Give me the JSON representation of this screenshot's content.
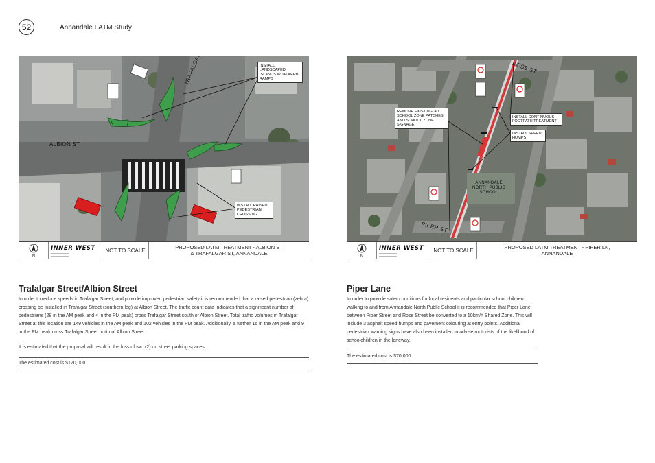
{
  "header": {
    "page_number": "52",
    "document_title": "Annandale LATM Study"
  },
  "left_panel": {
    "map": {
      "street_labels": [
        "TRAFALGAR ST",
        "ALBION ST"
      ],
      "callouts": [
        "INSTALL\nLANDSCAPED\nISLANDS WITH KERB\nRAMPS",
        "INSTALL RAISED\nPEDESTRIAN\nCROSSING"
      ]
    },
    "title_block": {
      "north_label": "N",
      "brand": "INNER WEST",
      "scale": "NOT TO SCALE",
      "title": "PROPOSED LATM TREATMENT - ALBION ST\n& TRAFALGAR ST,  ANNANDALE"
    },
    "heading": "Trafalgar Street/Albion Street",
    "paragraph_1": "In order to reduce speeds in Trafalgar Street, and provide improved pedestrian safety it is recommended that a raised pedestrian (zebra) crossing be installed in Trafalgar Street (southern leg) at Albion Street.  The traffic count data indicates that a significant number of pedestrians (28 in the AM peak and 4 in the PM peak) cross Trafalgar Street south of Albion Street. Total traffic volumes in Trafalgar Street at this location are 149 vehicles in the AM peak and 102 vehicles in the PM peak. Additionally, a further 16 in the AM peak and 9 in the PM peak cross Trafalgar Street north of Albion Street.",
    "paragraph_2": "It is estimated that the proposal will result in the loss of two (2) on street parking spaces.",
    "cost": "The estimated cost is $120,000."
  },
  "right_panel": {
    "map": {
      "street_labels": [
        "ROSE ST",
        "PIPER ST"
      ],
      "callouts": [
        "REMOVE EXISTING '40'\nSCHOOL ZONE PATCHES\nAND SCHOOL ZONE\nSIGNAGE",
        "INSTALL CONTINUOUS\nFOOTPATH TREATMENT",
        "INSTALL SPEED\nHUMPS"
      ],
      "school_label": "ANNANDALE\nNORTH PUBLIC\nSCHOOL"
    },
    "title_block": {
      "north_label": "N",
      "brand": "INNER WEST",
      "scale": "NOT TO SCALE",
      "title": "PROPOSED LATM TREATMENT - PIPER LN,\nANNANDALE"
    },
    "heading": "Piper Lane",
    "paragraph_1": "In order to provide safer conditions for local residents and particular school children walking to and from Annandale North Public School it is recommended that Piper Lane between Piper Street and Rose Street be converted to a 10km/h Shared Zone. This will include 3 asphalt speed humps and pavement colouring at entry points. Additional pedestrian warning signs have also been installed to advise motorists of the likelihood of schoolchildren in the laneway.",
    "cost": "The estimated cost is $70,000."
  },
  "colors": {
    "island_green": "#3f9e4b",
    "vehicle_red": "#d81e1e",
    "shared_zone_red": "#d33a3a"
  }
}
